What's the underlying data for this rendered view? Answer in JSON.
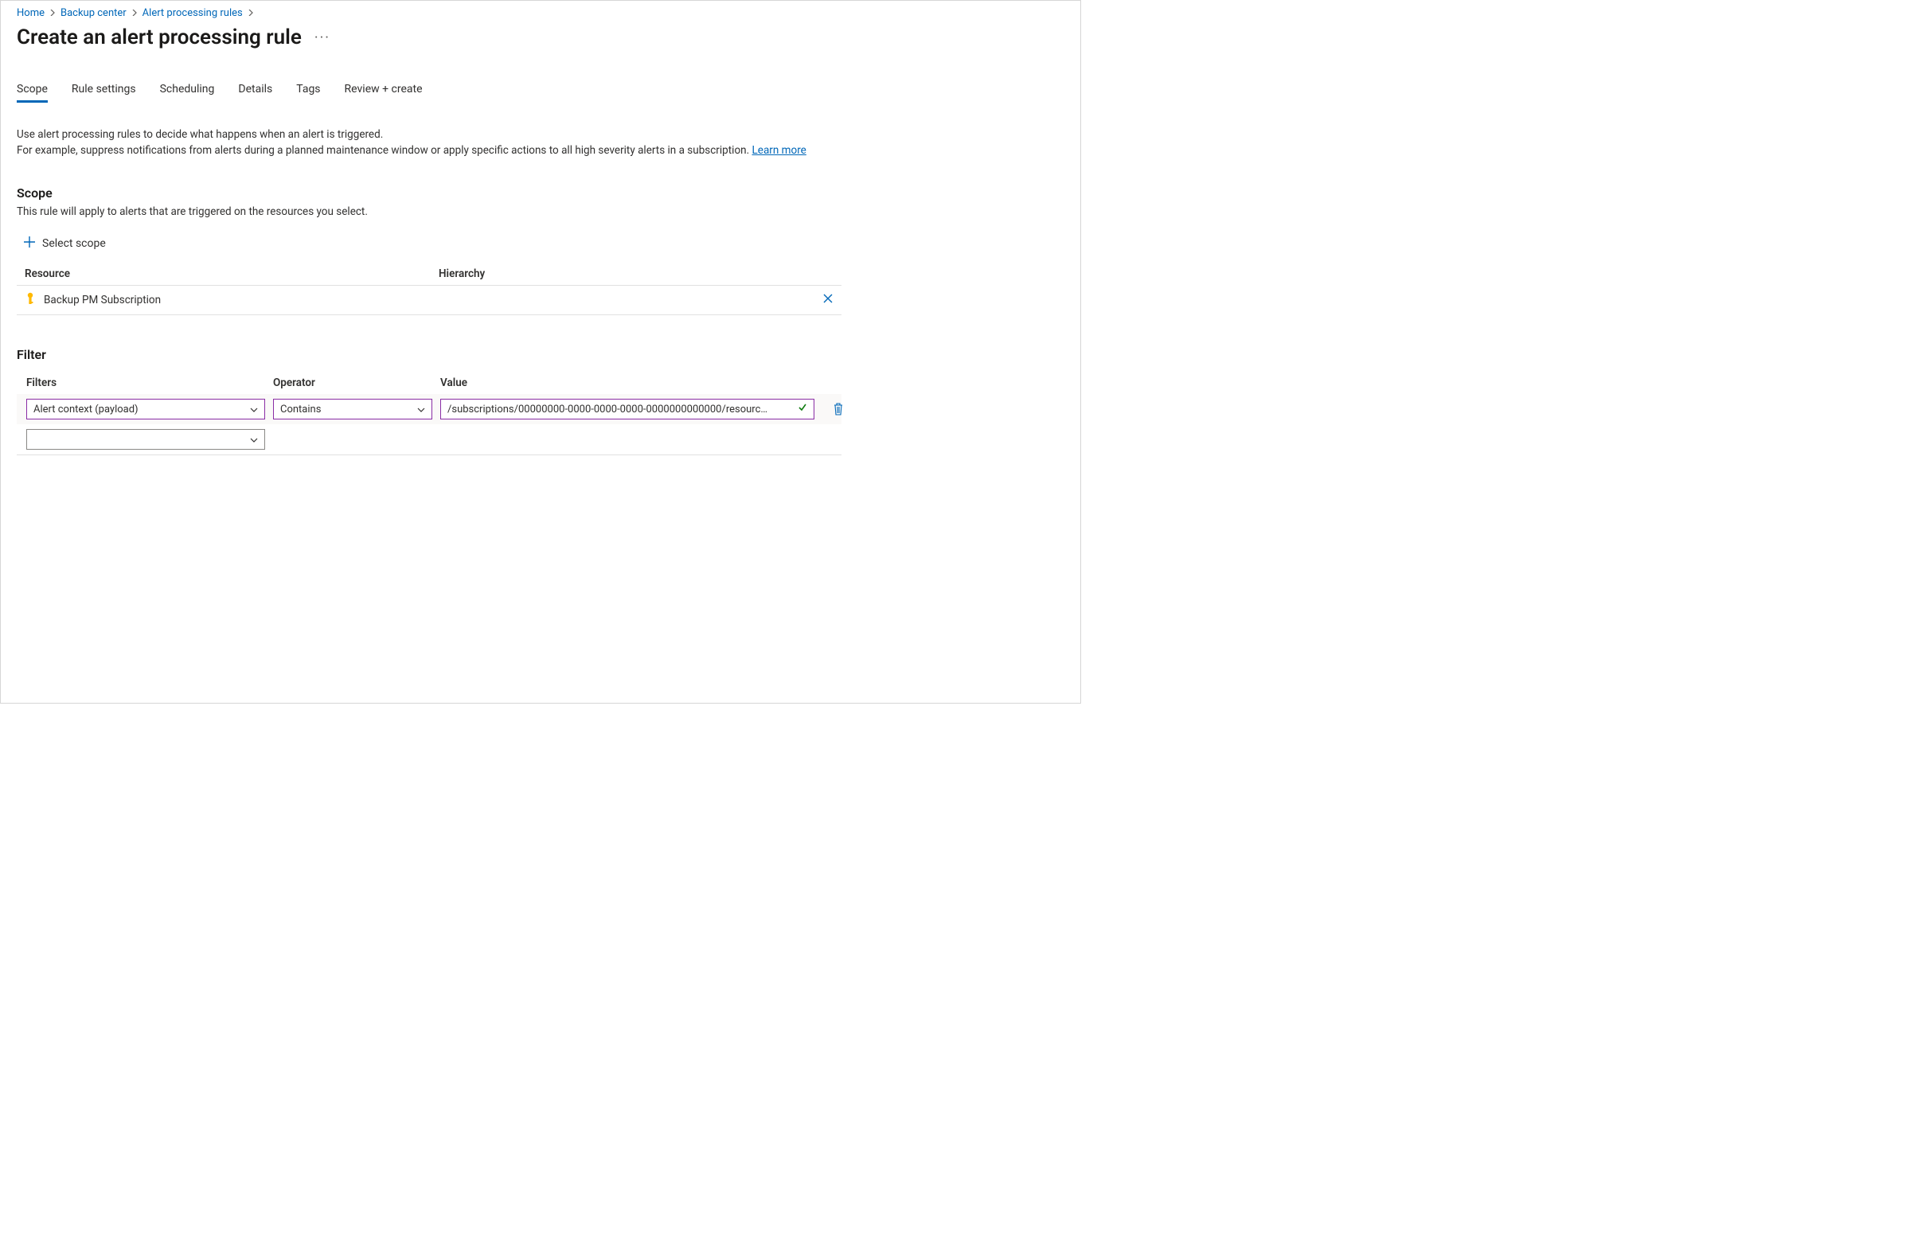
{
  "breadcrumb": {
    "items": [
      {
        "label": "Home"
      },
      {
        "label": "Backup center"
      },
      {
        "label": "Alert processing rules"
      }
    ]
  },
  "page": {
    "title": "Create an alert processing rule"
  },
  "tabs": [
    {
      "label": "Scope",
      "active": true
    },
    {
      "label": "Rule settings"
    },
    {
      "label": "Scheduling"
    },
    {
      "label": "Details"
    },
    {
      "label": "Tags"
    },
    {
      "label": "Review + create"
    }
  ],
  "intro": {
    "line1": "Use alert processing rules to decide what happens when an alert is triggered.",
    "line2_prefix": "For example, suppress notifications from alerts during a planned maintenance window or apply specific actions to all high severity alerts in a subscription. ",
    "learn_more": "Learn more"
  },
  "scope": {
    "heading": "Scope",
    "subtext": "This rule will apply to alerts that are triggered on the resources you select.",
    "select_scope_label": "Select scope",
    "table": {
      "col_resource": "Resource",
      "col_hierarchy": "Hierarchy",
      "rows": [
        {
          "resource": "Backup PM Subscription",
          "hierarchy": ""
        }
      ]
    }
  },
  "filter": {
    "heading": "Filter",
    "col_filters": "Filters",
    "col_operator": "Operator",
    "col_value": "Value",
    "rows": [
      {
        "filter_selected": "Alert context (payload)",
        "operator_selected": "Contains",
        "value": "/subscriptions/00000000-0000-0000-0000-0000000000000/resourc…"
      }
    ],
    "empty_row": {
      "filter_selected": ""
    }
  }
}
